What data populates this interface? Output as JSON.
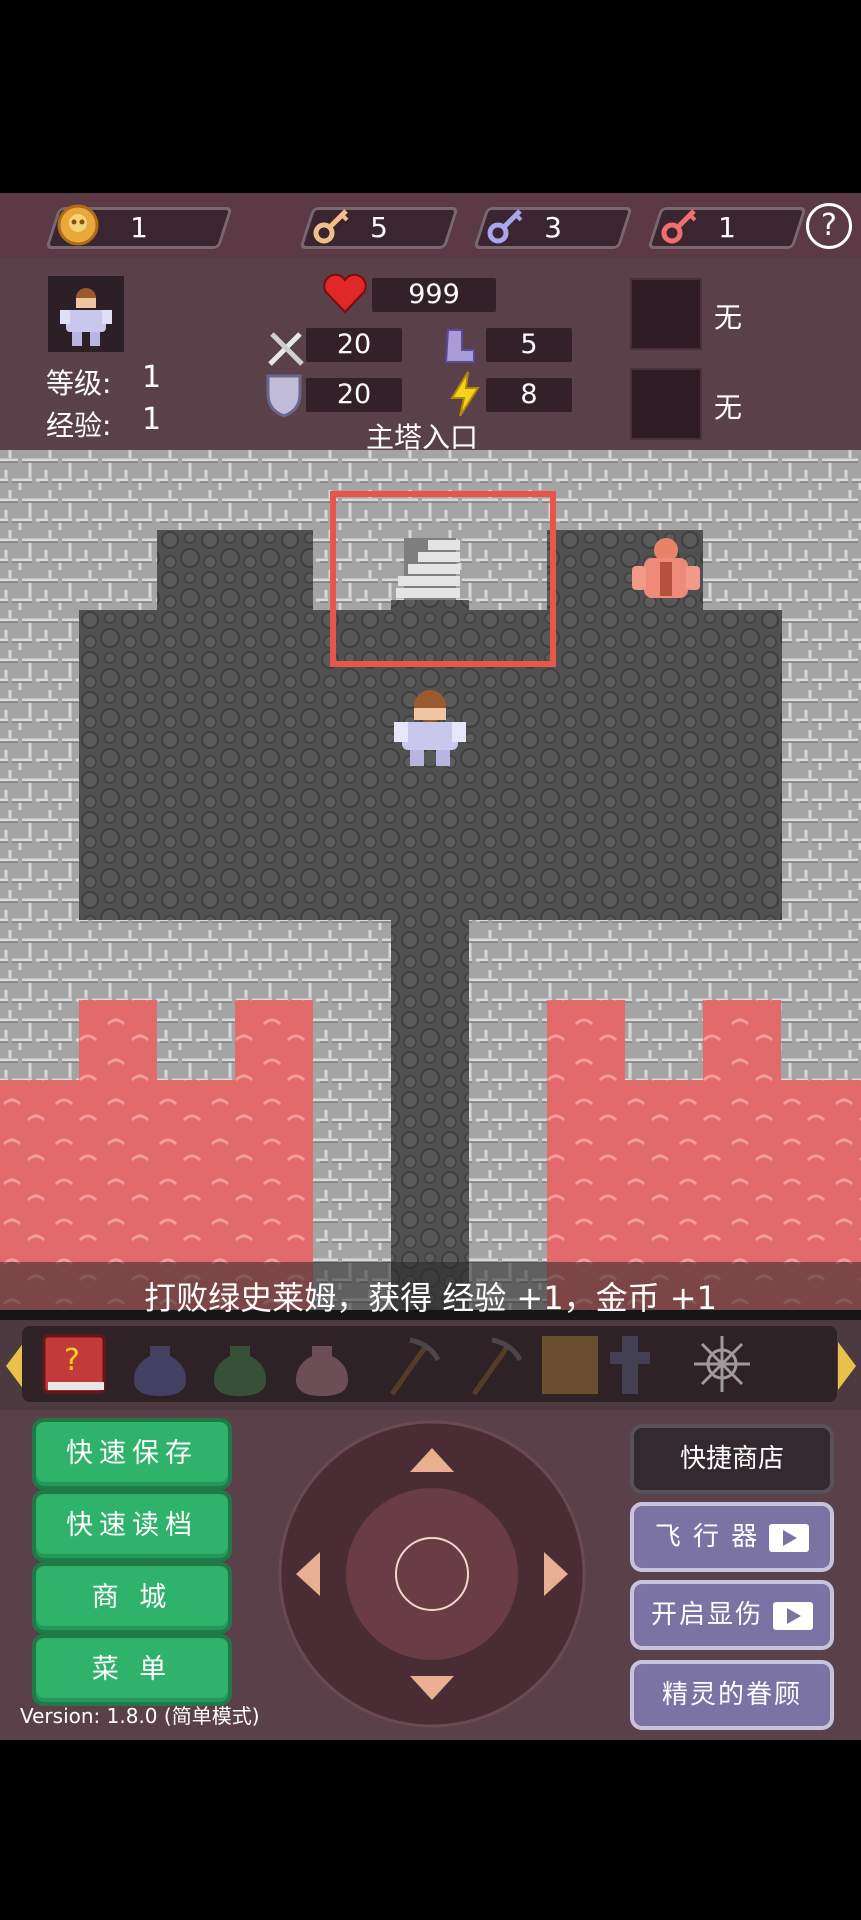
{
  "resources": {
    "coins": "1",
    "yellow_keys": "5",
    "blue_keys": "3",
    "red_keys": "1",
    "help_label": "?"
  },
  "hero": {
    "level_label": "等级:",
    "level_value": "1",
    "exp_label": "经验:",
    "exp_value": "1"
  },
  "stats": {
    "hp": "999",
    "attack": "20",
    "agility": "5",
    "defense": "20",
    "magic": "8"
  },
  "equipment": {
    "slot1_label": "无",
    "slot2_label": "无"
  },
  "floor_name": "主塔入口",
  "message": "打败绿史莱姆，获得 经验 +1，金币 +1",
  "items": [
    "monster-manual",
    "blue-potion-jar",
    "green-potion-jar",
    "pink-potion-jar",
    "pickaxe",
    "pickaxe-2",
    "gold-scroll",
    "shadow-cross",
    "compass-star"
  ],
  "controls": {
    "quick_save": "快速保存",
    "quick_load": "快速读档",
    "shop": "商 城",
    "menu": "菜 单",
    "quick_shop": "快捷商店",
    "flyer": "飞 行 器",
    "show_damage": "开启显伤",
    "fairy_favor": "精灵的眷顾",
    "version": "Version: 1.8.0 (简单模式)"
  },
  "colors": {
    "lava": "#e06a6a",
    "floor": "#505050",
    "wall": "#a0a0a0",
    "highlight": "#e8554a"
  }
}
